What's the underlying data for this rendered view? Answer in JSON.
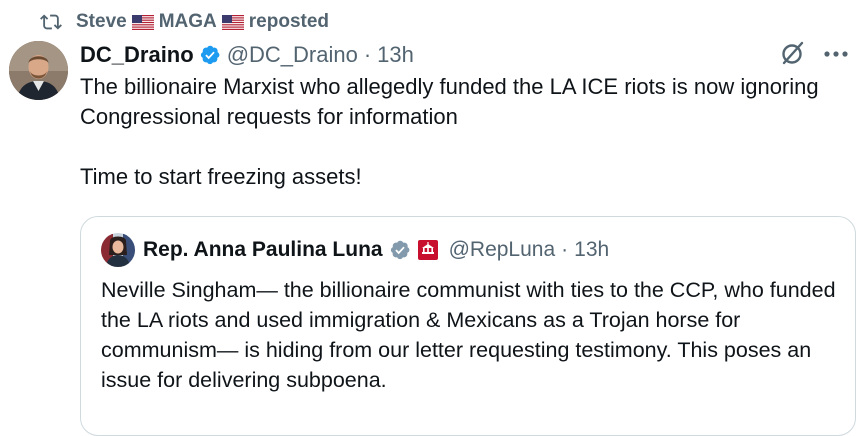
{
  "repost": {
    "user_name_part1": "Steve",
    "user_name_part2": "MAGA",
    "action": "reposted",
    "icons": [
      "repost-icon",
      "us-flag-icon",
      "us-flag-icon"
    ]
  },
  "tweet": {
    "author_name": "DC_Draino",
    "author_handle": "@DC_Draino",
    "separator": "·",
    "time": "13h",
    "verified": true,
    "text": "The billionaire Marxist who allegedly funded the LA ICE riots is now ignoring Congressional requests for information\n\nTime to start freezing assets!",
    "icons": [
      "grok-icon",
      "more-icon"
    ]
  },
  "quote": {
    "author_name": "Rep. Anna Paulina Luna",
    "author_handle": "@RepLuna",
    "separator": "·",
    "time": "13h",
    "badges": [
      "government-verified-icon",
      "us-congress-affiliation-icon"
    ],
    "text": "Neville Singham— the billionaire communist with ties to the CCP, who funded the LA riots and used immigration & Mexicans as a Trojan horse for communism— is hiding from our letter requesting testimony. This poses an issue for delivering subpoena."
  },
  "colors": {
    "text_primary": "#0f1419",
    "text_secondary": "#536471",
    "verified_blue": "#1d9bf0",
    "gov_gray": "#829aab",
    "border": "#cfd9de"
  }
}
